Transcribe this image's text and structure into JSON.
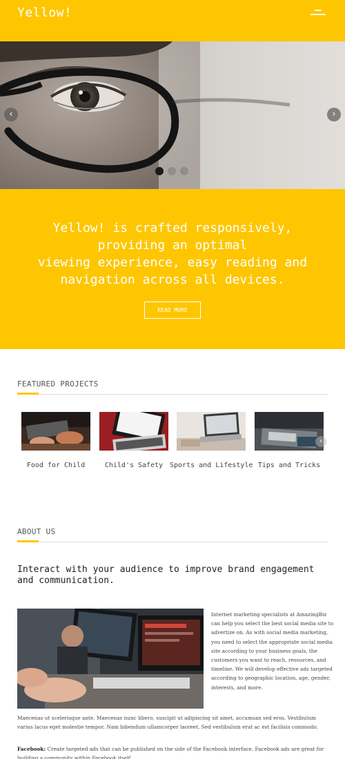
{
  "header": {
    "brand": "Yellow!",
    "menu_icon": "hamburger-menu-icon"
  },
  "slider": {
    "prev_icon": "chevron-left-icon",
    "next_icon": "chevron-right-icon",
    "prev_glyph": "‹",
    "next_glyph": "›",
    "slide_count": 3,
    "active_slide": 1
  },
  "intro": {
    "line1": "Yellow! is crafted responsively,",
    "line2": "providing an optimal",
    "line3": "viewing experience, easy reading and",
    "line4": "navigation across all devices.",
    "button": "READ MORE"
  },
  "featured": {
    "title": "FEATURED PROJECTS",
    "next_glyph": "›",
    "items": [
      {
        "label": "Food for Child"
      },
      {
        "label": "Child's Safety"
      },
      {
        "label": "Sports and Lifestyle"
      },
      {
        "label": "Tips and Tricks"
      }
    ]
  },
  "about": {
    "title": "ABOUT US",
    "heading": "Interact with your audience to improve brand engagement and communication.",
    "side_text": "Internet marketing specialists at AmazingBiz can help you select the best social media site to advertize on. As with social media marketing, you need to select the appropriate social media site according to your business goals, the customers you want to reach, resources, and timeline. We will develop effective ads targeted according to geographic location, age, gender, interests, and more.",
    "paragraph2": "Maecenas ut scelerisque ante. Maecenas nunc libero, suscipit ut adipiscing sit amet, accumsan sed eros. Vestibulum varius lacus eget molestie tempor. Nam bibendum ullamcorper laoreet. Sed vestibulum erat ac est facilisis commodo.",
    "paragraph3_label": "Facebook:",
    "paragraph3": " Create targeted ads that can be published on the side of the Facebook interface. Facebook ads are great for building a community within Facebook itself."
  },
  "colors": {
    "accent": "#fec601",
    "text": "#333333"
  }
}
